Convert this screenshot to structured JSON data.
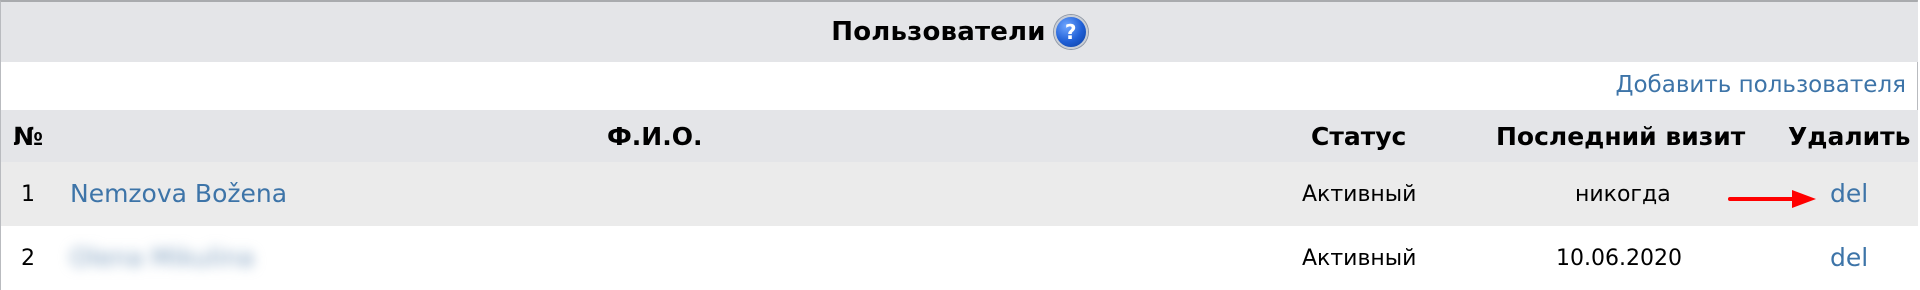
{
  "header": {
    "title": "Пользователи",
    "help_icon": "help-question-icon"
  },
  "toolbar": {
    "add_user_label": "Добавить пользователя"
  },
  "table": {
    "columns": [
      "№",
      "Ф.И.О.",
      "Статус",
      "Последний визит",
      "Удалить"
    ],
    "rows": [
      {
        "num": "1",
        "name": "Nemzova Božena",
        "status": "Активный",
        "last_visit": "никогда",
        "delete": "del"
      },
      {
        "num": "2",
        "name": "Olena Mikulina",
        "status": "Активный",
        "last_visit": "10.06.2020",
        "delete": "del"
      }
    ]
  },
  "annotation": {
    "arrow_icon": "red-arrow-icon",
    "color": "#ff0000"
  },
  "colors": {
    "link": "#3d74a8",
    "header_bg": "#e4e5e8",
    "row_alt_bg": "#ebebeb"
  }
}
